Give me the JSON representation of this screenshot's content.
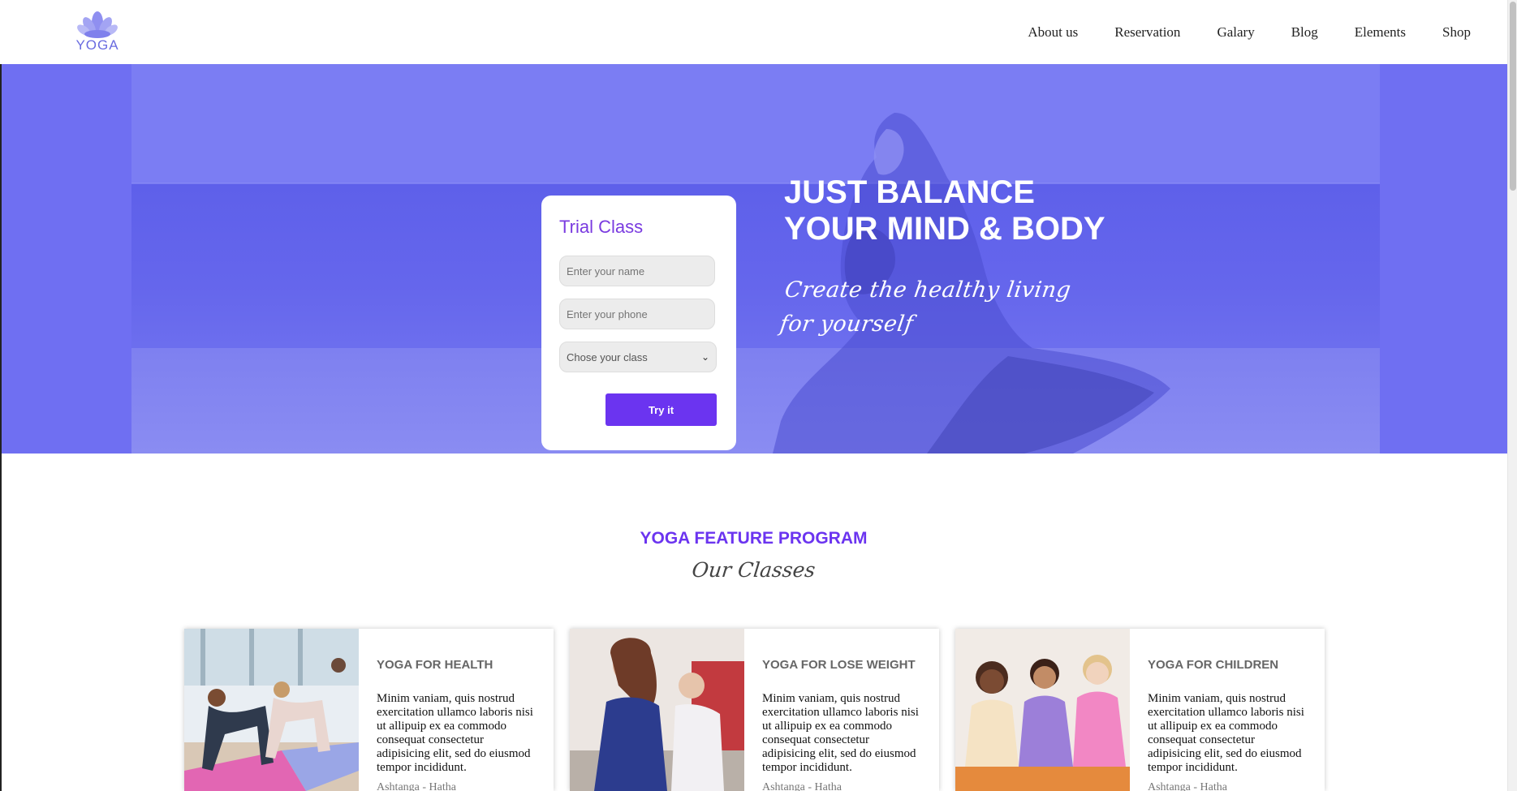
{
  "header": {
    "logo_text": "YOGA",
    "nav": [
      "About us",
      "Reservation",
      "Galary",
      "Blog",
      "Elements",
      "Shop"
    ]
  },
  "hero": {
    "heading_line1": "JUST BALANCE",
    "heading_line2": "YOUR MIND & BODY",
    "script_line1": "Create the healthy living",
    "script_line2": "for yourself"
  },
  "trial": {
    "title": "Trial Class",
    "name_placeholder": "Enter your name",
    "phone_placeholder": "Enter your phone",
    "class_select": "Chose your class",
    "button_label": "Try it"
  },
  "feature": {
    "title": "YOGA FEATURE PROGRAM",
    "subtitle": "Our Classes"
  },
  "cards": [
    {
      "title": "YOGA FOR HEALTH",
      "text": "Minim vaniam, quis nostrud exercitation ullamco laboris nisi ut allipuip ex ea commodo consequat consectetur adipisicing elit, sed do eiusmod tempor incididunt.",
      "tag": "Ashtanga - Hatha"
    },
    {
      "title": "YOGA FOR LOSE WEIGHT",
      "text": "Minim vaniam, quis nostrud exercitation ullamco laboris nisi ut allipuip ex ea commodo consequat consectetur adipisicing elit, sed do eiusmod tempor incididunt.",
      "tag": "Ashtanga - Hatha"
    },
    {
      "title": "YOGA FOR CHILDREN",
      "text": "Minim vaniam, quis nostrud exercitation ullamco laboris nisi ut allipuip ex ea commodo consequat consectetur adipisicing elit, sed do eiusmod tempor incididunt.",
      "tag": "Ashtanga - Hatha"
    }
  ],
  "colors": {
    "accent": "#6b34f0",
    "hero_overlay": "#6f6ff2",
    "logo": "#6a6ce0"
  },
  "icons": {
    "logo": "lotus-icon",
    "select_chevron": "chevron-down-icon"
  }
}
